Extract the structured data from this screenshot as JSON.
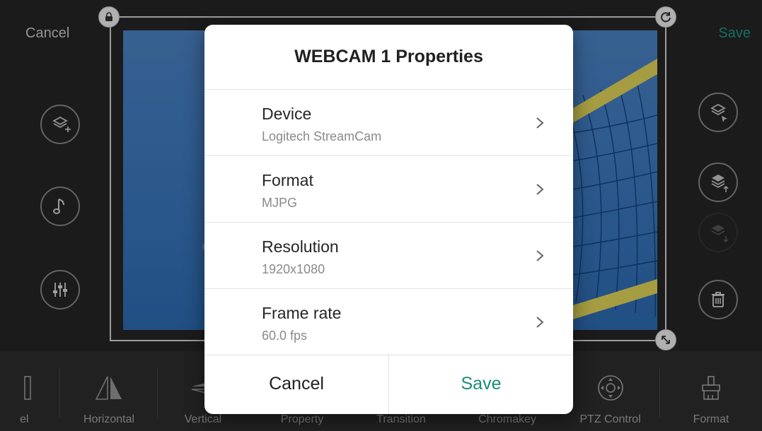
{
  "top_bar": {
    "cancel_label": "Cancel",
    "save_label": "Save"
  },
  "preview": {
    "source": "WEBCAM 1"
  },
  "left_controls": [
    {
      "icon": "add-layer-icon"
    },
    {
      "icon": "music-note-icon"
    },
    {
      "icon": "mixer-sliders-icon"
    }
  ],
  "right_controls": [
    {
      "icon": "select-layer-icon"
    },
    {
      "icon": "layer-up-icon"
    },
    {
      "icon": "layer-down-icon",
      "disabled": true
    },
    {
      "icon": "trash-icon"
    }
  ],
  "toolbar": {
    "items": [
      {
        "label": "el",
        "icon": "partial-icon"
      },
      {
        "label": "Horizontal",
        "icon": "flip-horizontal-icon"
      },
      {
        "label": "Vertical",
        "icon": "flip-vertical-icon"
      },
      {
        "label": "Property",
        "icon": "property-icon"
      },
      {
        "label": "Transition",
        "icon": "transition-icon"
      },
      {
        "label": "Chromakey",
        "icon": "chromakey-icon"
      },
      {
        "label": "PTZ Control",
        "icon": "ptz-control-icon"
      },
      {
        "label": "Format",
        "icon": "format-brush-icon"
      }
    ]
  },
  "dialog": {
    "title": "WEBCAM 1 Properties",
    "rows": [
      {
        "label": "Device",
        "value": "Logitech StreamCam"
      },
      {
        "label": "Format",
        "value": "MJPG"
      },
      {
        "label": "Resolution",
        "value": "1920x1080"
      },
      {
        "label": "Frame rate",
        "value": "60.0 fps"
      }
    ],
    "cancel_label": "Cancel",
    "save_label": "Save"
  },
  "colors": {
    "accent": "#1a8c7c",
    "background": "#262626",
    "dialog": "#ffffff"
  }
}
